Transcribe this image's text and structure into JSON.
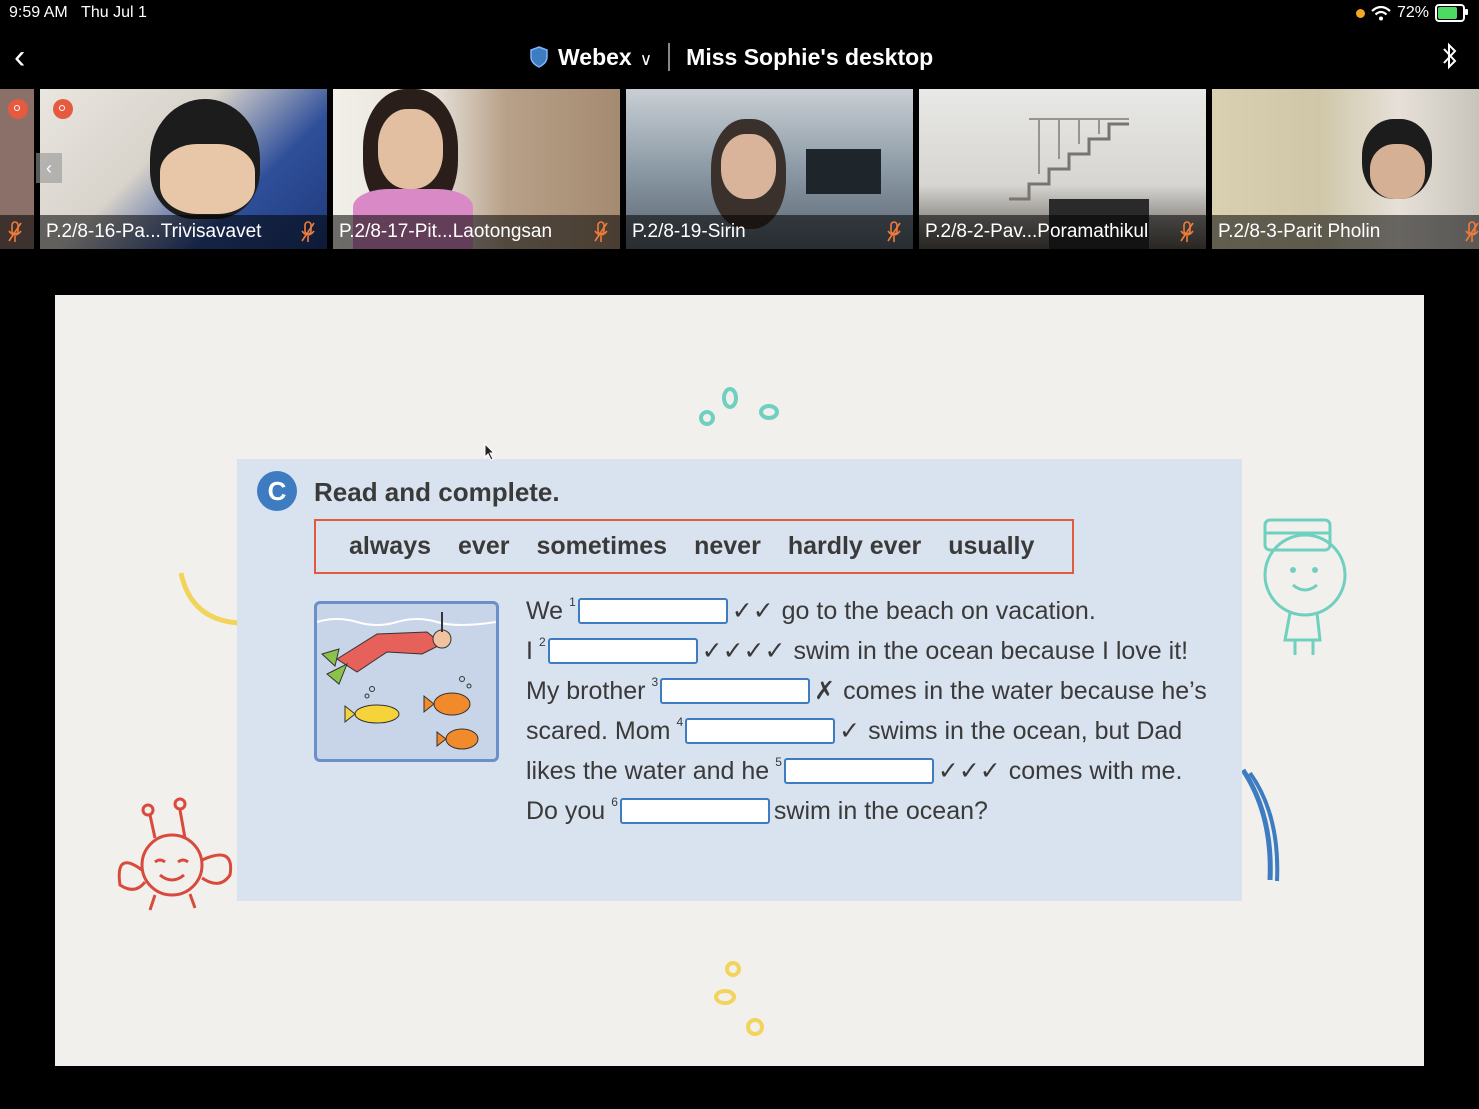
{
  "status_bar": {
    "time": "9:59 AM",
    "date": "Thu Jul 1",
    "battery": "72%",
    "battery_level": 0.72
  },
  "nav": {
    "app": "Webex",
    "title": "Miss Sophie's desktop"
  },
  "participants": [
    {
      "name": "P.2/8-16-Pa...Trivisavavet",
      "muted": true
    },
    {
      "name": "P.2/8-17-Pit...Laotongsan",
      "muted": true
    },
    {
      "name": "P.2/8-19-Sirin",
      "muted": true
    },
    {
      "name": "P.2/8-2-Pav...Poramathikul",
      "muted": true
    },
    {
      "name": "P.2/8-3-Parit Pholin",
      "muted": true
    }
  ],
  "slide": {
    "badge": "C",
    "instruction": "Read and complete.",
    "words": [
      "always",
      "ever",
      "sometimes",
      "never",
      "hardly ever",
      "usually"
    ],
    "lines": [
      {
        "pre": "We",
        "num": "1",
        "checks": "✓✓",
        "post": "go to the beach on vacation."
      },
      {
        "pre": "I",
        "num": "2",
        "checks": "✓✓✓✓",
        "post": "swim in the ocean because I love it!"
      },
      {
        "pre": "My brother",
        "num": "3",
        "checks": "✗",
        "post": "comes in the water because he’s"
      },
      {
        "pre": "scared. Mom",
        "num": "4",
        "checks": "✓",
        "post": "swims in the ocean, but Dad"
      },
      {
        "pre": "likes the water and he",
        "num": "5",
        "checks": "✓✓✓",
        "post": "comes with me."
      },
      {
        "pre": "Do you",
        "num": "6",
        "checks": "",
        "post": "swim in the ocean?"
      }
    ]
  },
  "colors": {
    "accent_blue": "#3e7cc1",
    "word_box_border": "#e05a3c",
    "card_bg": "#d9e2ef",
    "slide_bg": "#f1f0ed"
  }
}
